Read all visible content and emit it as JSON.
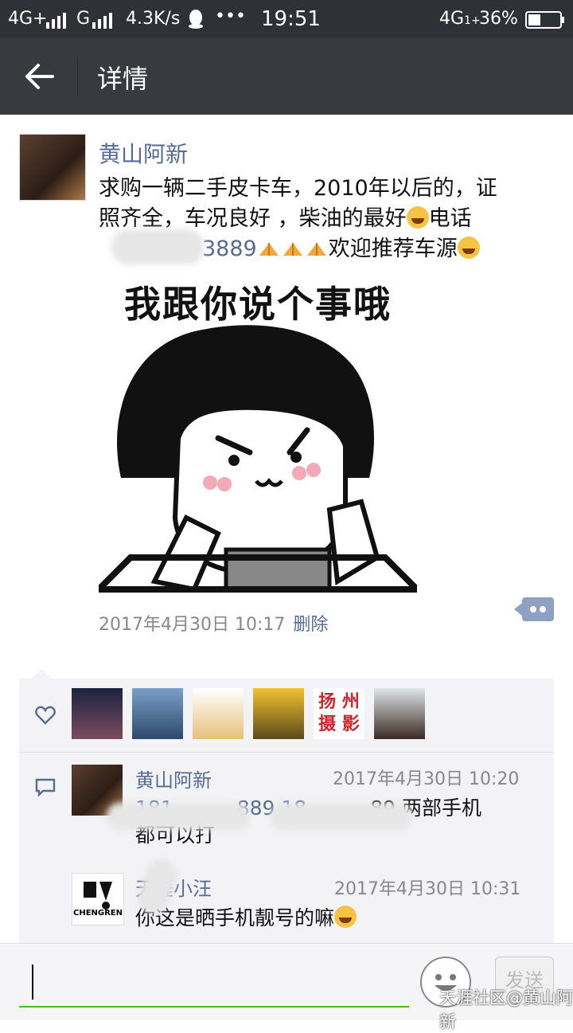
{
  "status_bar": {
    "network1": "4G+",
    "network2": "G",
    "speed": "4.3K/s",
    "more": "•••",
    "time": "19:51",
    "network3": "4G",
    "battery": "36%"
  },
  "nav": {
    "title": "详情"
  },
  "post": {
    "author": "黄山阿新",
    "text_line1": "求购一辆二手皮卡车，2010年以后的，证",
    "text_line2": "照齐全，车况良好 ，柴油的最好",
    "text_line2b": "电话",
    "text_line3_num": "3889",
    "text_line3_tail": "欢迎推荐车源",
    "meme_caption": "我跟你说个事哦",
    "time": "2017年4月30日 10:17",
    "delete": "删除"
  },
  "likes": {
    "avatars": [
      {
        "name": "night-sky-avatar",
        "c1": "#1c2340",
        "c2": "#7a4b5e"
      },
      {
        "name": "city-tower-avatar",
        "c1": "#7aa0c8",
        "c2": "#2d4a6b"
      },
      {
        "name": "cartoon-avatar",
        "c1": "#ffffff",
        "c2": "#e8c07a"
      },
      {
        "name": "shop-avatar",
        "c1": "#f2c230",
        "c2": "#5a4a1a"
      },
      {
        "name": "yangzhou-photo-avatar",
        "c1": "#ffffff",
        "c2": "#ffffff",
        "text": "扬 州\n摄 影"
      },
      {
        "name": "girl-avatar",
        "c1": "#dfe6ea",
        "c2": "#3a2a22"
      }
    ]
  },
  "comments": [
    {
      "name": "黄山阿新",
      "time": "2017年4月30日 10:20",
      "line1_a": "181",
      "line1_b": "889 18",
      "line1_c": "89 两部手机",
      "line2": "都可以打"
    },
    {
      "name": "天涯小汪",
      "time": "2017年4月30日 10:31",
      "line1": "你这是晒手机靓号的嘛",
      "logo_text": "CHENGREN"
    }
  ],
  "input": {
    "send": "发送"
  },
  "watermark": "天涯社区@黄山阿新",
  "colors": {
    "link": "#576b95",
    "navbar": "#393a3f",
    "statusbar": "#2e3135",
    "accent_green": "#45c01a"
  }
}
